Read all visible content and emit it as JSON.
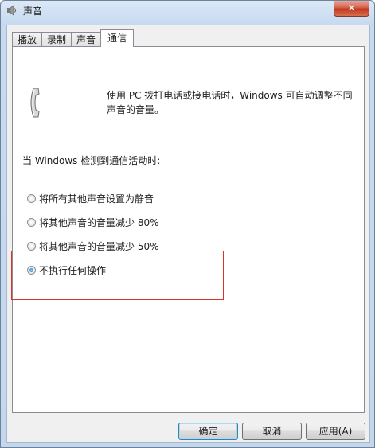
{
  "window": {
    "title": "声音",
    "close_label": "✕"
  },
  "tabs": [
    {
      "label": "播放",
      "active": false
    },
    {
      "label": "录制",
      "active": false
    },
    {
      "label": "声音",
      "active": false
    },
    {
      "label": "通信",
      "active": true
    }
  ],
  "communications": {
    "description": "使用 PC 拨打电话或接电话时，Windows 可自动调整不同声音的音量。",
    "prompt": "当 Windows 检测到通信活动时:",
    "options": [
      {
        "label": "将所有其他声音设置为静音",
        "checked": false
      },
      {
        "label": "将其他声音的音量减少 80%",
        "checked": false
      },
      {
        "label": "将其他声音的音量减少 50%",
        "checked": false
      },
      {
        "label": "不执行任何操作",
        "checked": true
      }
    ]
  },
  "buttons": {
    "ok": "确定",
    "cancel": "取消",
    "apply": "应用(A)"
  },
  "colors": {
    "highlight_box": "#d9342b",
    "selected_radio": "#1a6fc0"
  }
}
